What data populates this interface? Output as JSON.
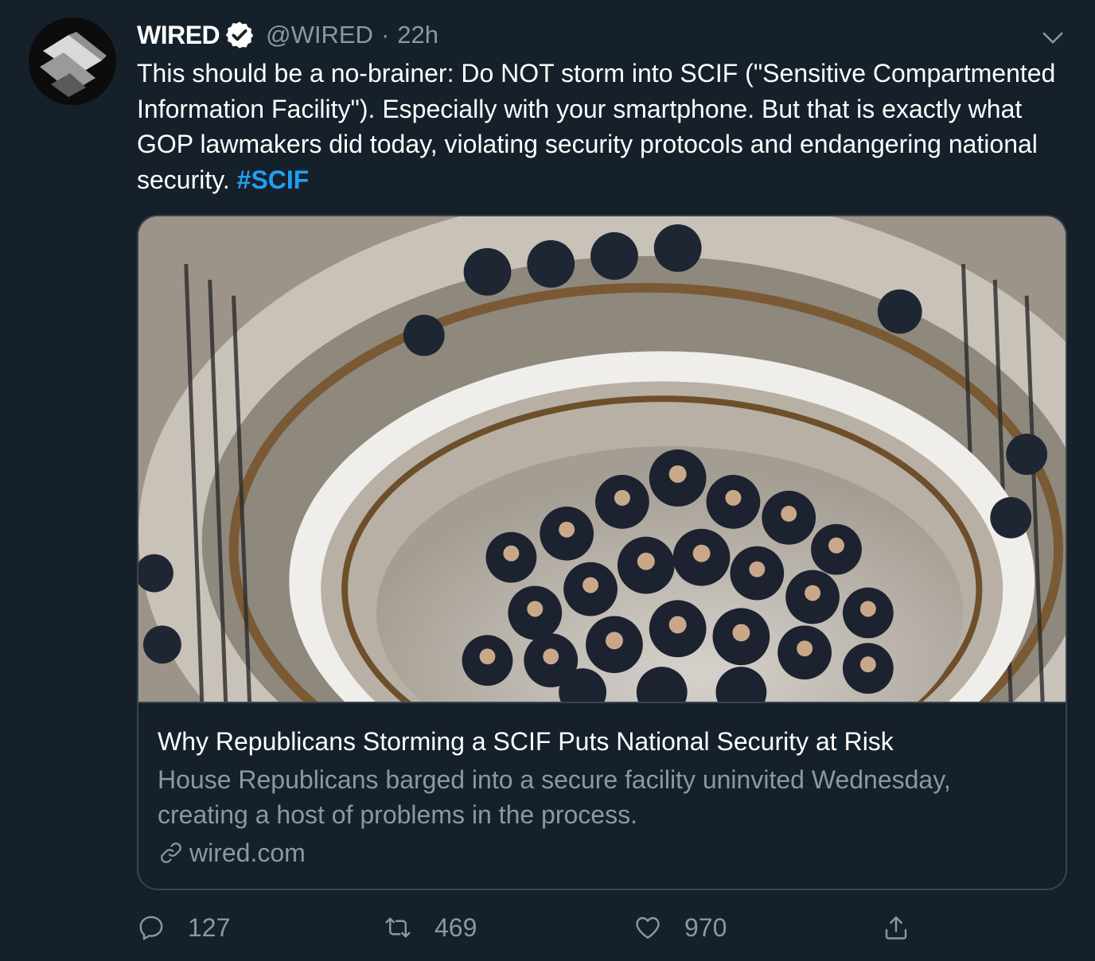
{
  "tweet": {
    "author": {
      "display_name": "WIRED",
      "handle": "@WIRED",
      "verified": true,
      "avatar_icon": "wired-logo-icon"
    },
    "separator": "·",
    "time": "22h",
    "text_main": "This should be a no-brainer: Do NOT storm into SCIF (\"Sensitive Compartmented Information Facility\"). Especially with your smartphone. But that is exactly what GOP lawmakers did today, violating security protocols and endangering national security. ",
    "hashtag": "#SCIF"
  },
  "card": {
    "image_icon": "photo-lawmakers-staircase",
    "title": "Why Republicans Storming a SCIF Puts National Security at Risk",
    "description": "House Republicans barged into a secure facility uninvited Wednesday, creating a host of problems in the process.",
    "domain": "wired.com"
  },
  "actions": {
    "replies": "127",
    "retweets": "469",
    "likes": "970"
  },
  "colors": {
    "background": "#15202b",
    "secondary_text": "#8899a6",
    "accent": "#1da1f2",
    "border": "#38444d"
  }
}
